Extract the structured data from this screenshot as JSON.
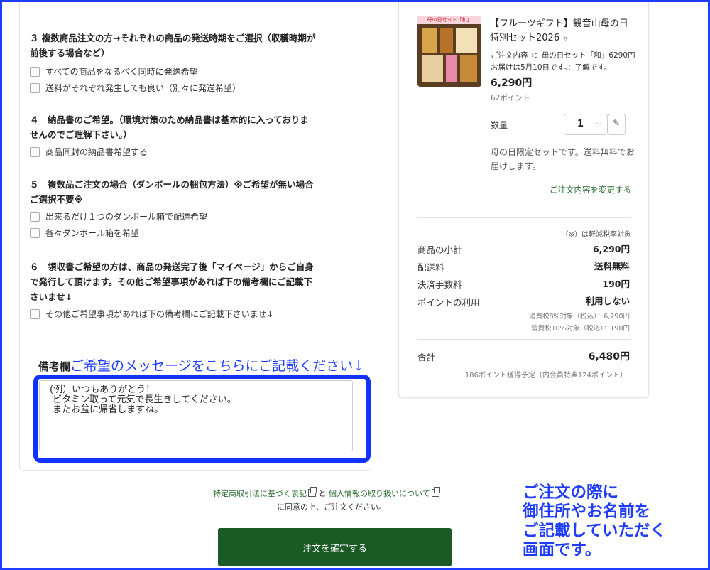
{
  "form": {
    "sec3": {
      "title_l1": "３ 複数商品注文の方→それぞれの商品の発送時期をご選択（収穫時期が",
      "title_l2": "前後する場合など）",
      "opt1": "すべての商品をなるべく同時に発送希望",
      "opt2": "送料がそれぞれ発生しても良い（別々に発送希望）"
    },
    "sec4": {
      "title_l1": "４　納品書のご希望。（環境対策のため納品書は基本的に入っておりま",
      "title_l2": "せんのでご理解下さい。）",
      "opt1": "商品同封の納品書希望する"
    },
    "sec5": {
      "title_l1": "５　複数品ご注文の場合（ダンボールの梱包方法）※ご希望が無い場合",
      "title_l2": "ご選択不要※",
      "opt1": "出来るだけ１つのダンボール箱で配達希望",
      "opt2": "各々ダンボール箱を希望"
    },
    "sec6": {
      "title_l1": "６　領収書ご希望の方は、商品の発送完了後「マイページ」からご自身",
      "title_l2": "で発行して頂けます。その他ご希望事項があれば下の備考欄にご記載下",
      "title_l3": "さいませ↓",
      "opt1": "その他ご希望事項があれば下の備考欄にご記載下さいませ↓"
    },
    "remarks": {
      "label": "備考欄",
      "annotation": "ご希望のメッセージをこちらにご記載ください↓",
      "text": "(例）いつもありがとう！\n ビタミン取って元気で長生きしてください。\n またお盆に帰省しますね。"
    }
  },
  "product": {
    "thumb_label": "母の日セット「和」",
    "name_l1": "【フルーツギフト】観音山母の日",
    "name_l2": "特別セット2026",
    "name_mark": "※",
    "option_l1": "ご注文内容→：母の日セット「和」6290円",
    "option_l2": "お届けは5月10日です。：了解です。",
    "price": "6,290円",
    "points": "62ポイント",
    "qty_label": "数量",
    "qty_value": "1",
    "note_l1": "母の日限定セットです。送料無料でお",
    "note_l2": "届けします。",
    "change_link": "ご注文内容を変更する"
  },
  "summary": {
    "tax_note": "（※）は軽減税率対象",
    "rows": [
      {
        "label": "商品の小計",
        "value": "6,290円"
      },
      {
        "label": "配送料",
        "value": "送料無料"
      },
      {
        "label": "決済手数料",
        "value": "190円"
      },
      {
        "label": "ポイントの利用",
        "value": "利用しない"
      }
    ],
    "tax8": "消費税8%対象（税込）：6,290円",
    "tax10": "消費税10%対象（税込）：190円",
    "total_label": "合計",
    "total_value": "6,480円",
    "points_note": "186ポイント獲得予定（内会員特典124ポイント）"
  },
  "footer": {
    "link1": "特定商取引法に基づく表記",
    "conj": "と",
    "link2": "個人情報の取り扱いについて",
    "agree": "に同意の上、ご注文ください。",
    "confirm_button": "注文を確定する"
  },
  "callout": {
    "l1": "ご注文の際に",
    "l2": "御住所やお名前を",
    "l3": "ご記載していただく",
    "l4": "画面です。"
  },
  "colors": {
    "accent_blue": "#1e3cff",
    "brand_green": "#1a5a25",
    "link_green": "#2a6b32"
  }
}
